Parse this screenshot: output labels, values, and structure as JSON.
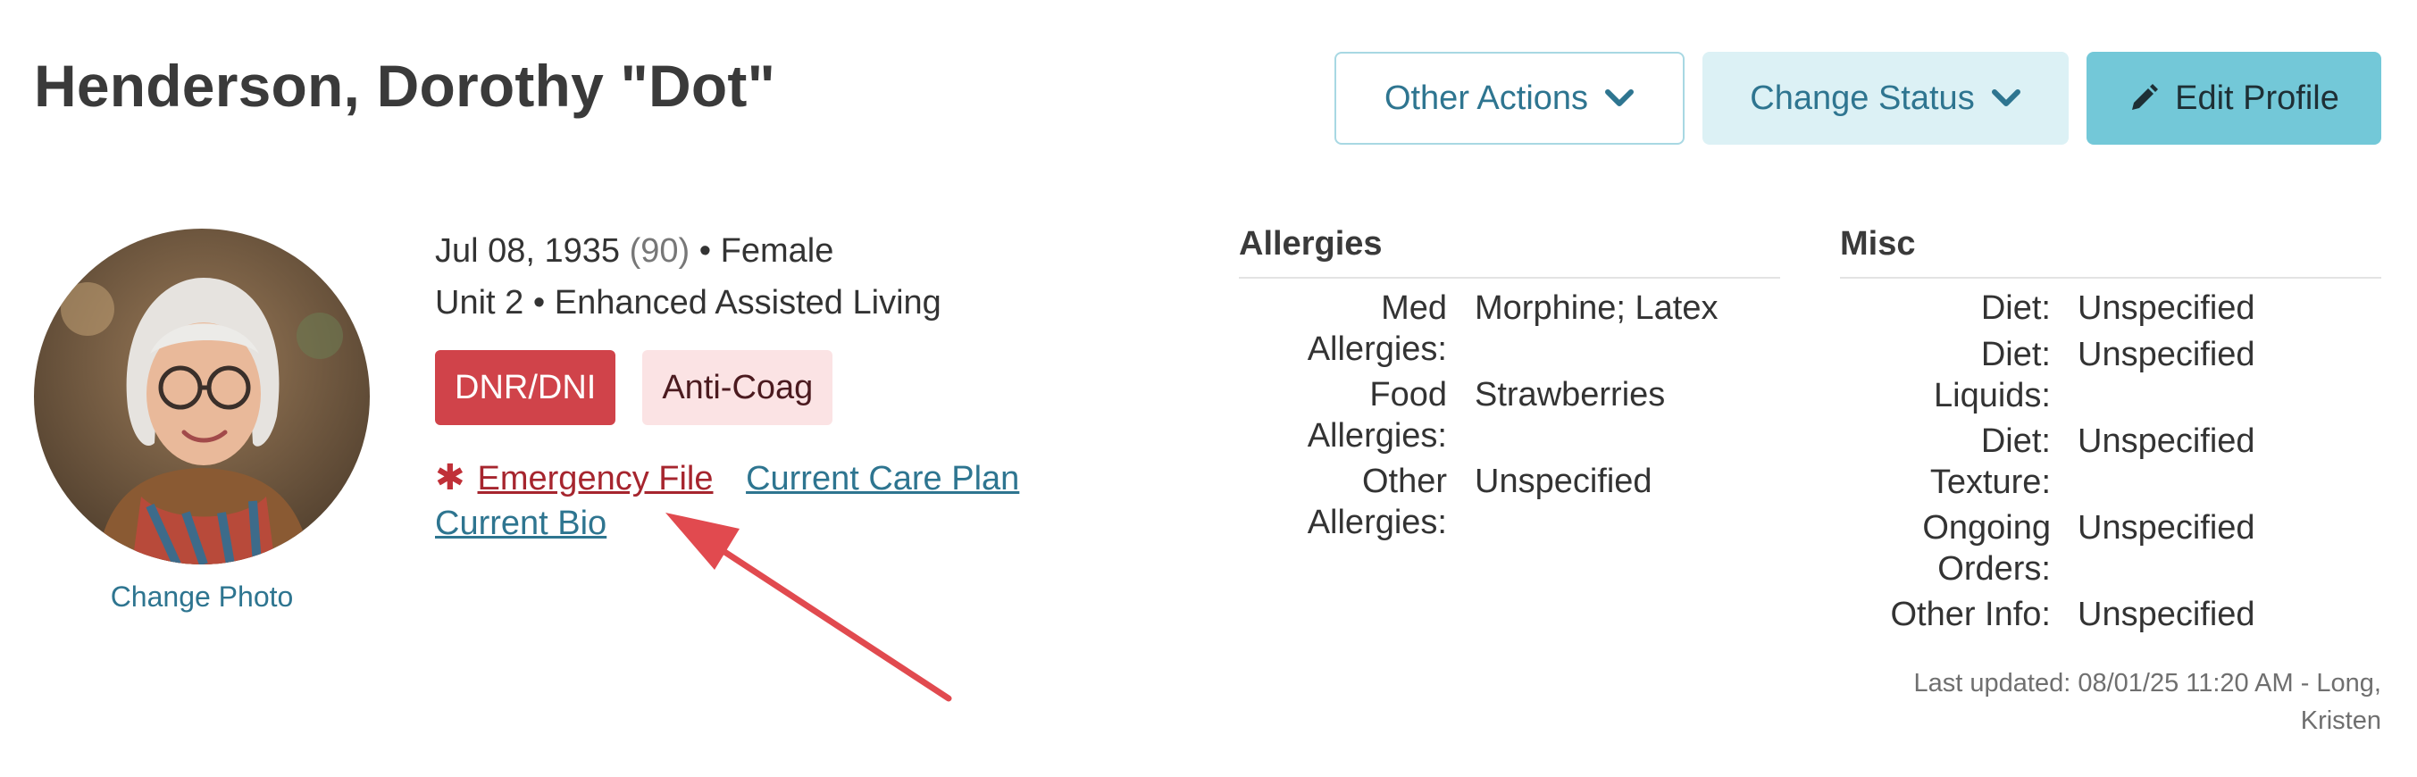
{
  "header": {
    "name": "Henderson, Dorothy \"Dot\"",
    "buttons": {
      "other_actions": "Other Actions",
      "change_status": "Change Status",
      "edit_profile": "Edit Profile"
    }
  },
  "profile": {
    "change_photo": "Change Photo",
    "dob": "Jul 08, 1935",
    "age": "(90)",
    "sep": "•",
    "gender": "Female",
    "unit": "Unit 2",
    "program": "Enhanced Assisted Living",
    "badges": {
      "dnr": "DNR/DNI",
      "anticoag": "Anti-Coag"
    },
    "links": {
      "emergency_icon": "✱",
      "emergency_file": "Emergency File",
      "care_plan": "Current Care Plan",
      "bio": "Current Bio"
    }
  },
  "allergies": {
    "title": "Allergies",
    "rows": [
      {
        "k1": "Med",
        "k2": "Allergies:",
        "v": "Morphine; Latex"
      },
      {
        "k1": "Food",
        "k2": "Allergies:",
        "v": "Strawberries"
      },
      {
        "k1": "Other",
        "k2": "Allergies:",
        "v": "Unspecified"
      }
    ]
  },
  "misc": {
    "title": "Misc",
    "rows": [
      {
        "k1": "Diet:",
        "k2": "",
        "v": "Unspecified"
      },
      {
        "k1": "Diet:",
        "k2": "Liquids:",
        "v": "Unspecified"
      },
      {
        "k1": "Diet:",
        "k2": "Texture:",
        "v": "Unspecified"
      },
      {
        "k1": "Ongoing",
        "k2": "Orders:",
        "v": "Unspecified"
      },
      {
        "k1": "Other Info:",
        "k2": "",
        "v": "Unspecified"
      }
    ],
    "last_updated_line1": "Last updated: 08/01/25 11:20 AM - Long,",
    "last_updated_line2": "Kristen"
  },
  "colors": {
    "accent": "#2e7590",
    "edit_button": "#73c8d8",
    "dnr_badge": "#d0434a",
    "annotation_arrow": "#e14a4f"
  }
}
